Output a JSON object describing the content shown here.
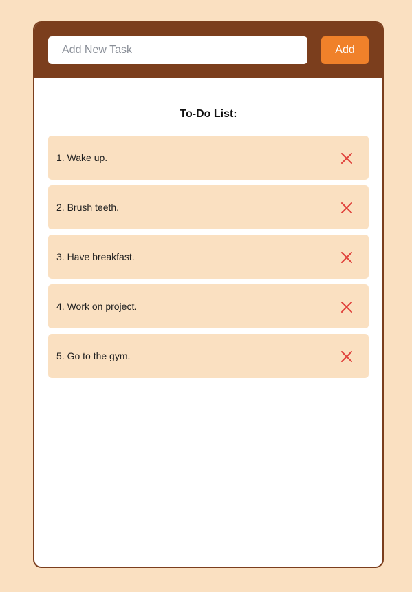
{
  "header": {
    "input_placeholder": "Add New Task",
    "input_value": "",
    "add_label": "Add"
  },
  "list": {
    "title": "To-Do List:",
    "items": [
      {
        "text": "1. Wake up.",
        "delete_icon": "close-x-icon"
      },
      {
        "text": "2. Brush teeth.",
        "delete_icon": "close-x-icon"
      },
      {
        "text": "3. Have breakfast.",
        "delete_icon": "close-x-icon"
      },
      {
        "text": "4. Work on project.",
        "delete_icon": "close-x-icon"
      },
      {
        "text": "5. Go to the gym.",
        "delete_icon": "close-x-icon"
      }
    ]
  },
  "colors": {
    "page_background": "#fae0c1",
    "header_background": "#7b3e1d",
    "add_button": "#f0812a",
    "task_background": "#fae0c1",
    "delete_icon": "#e0403a"
  }
}
